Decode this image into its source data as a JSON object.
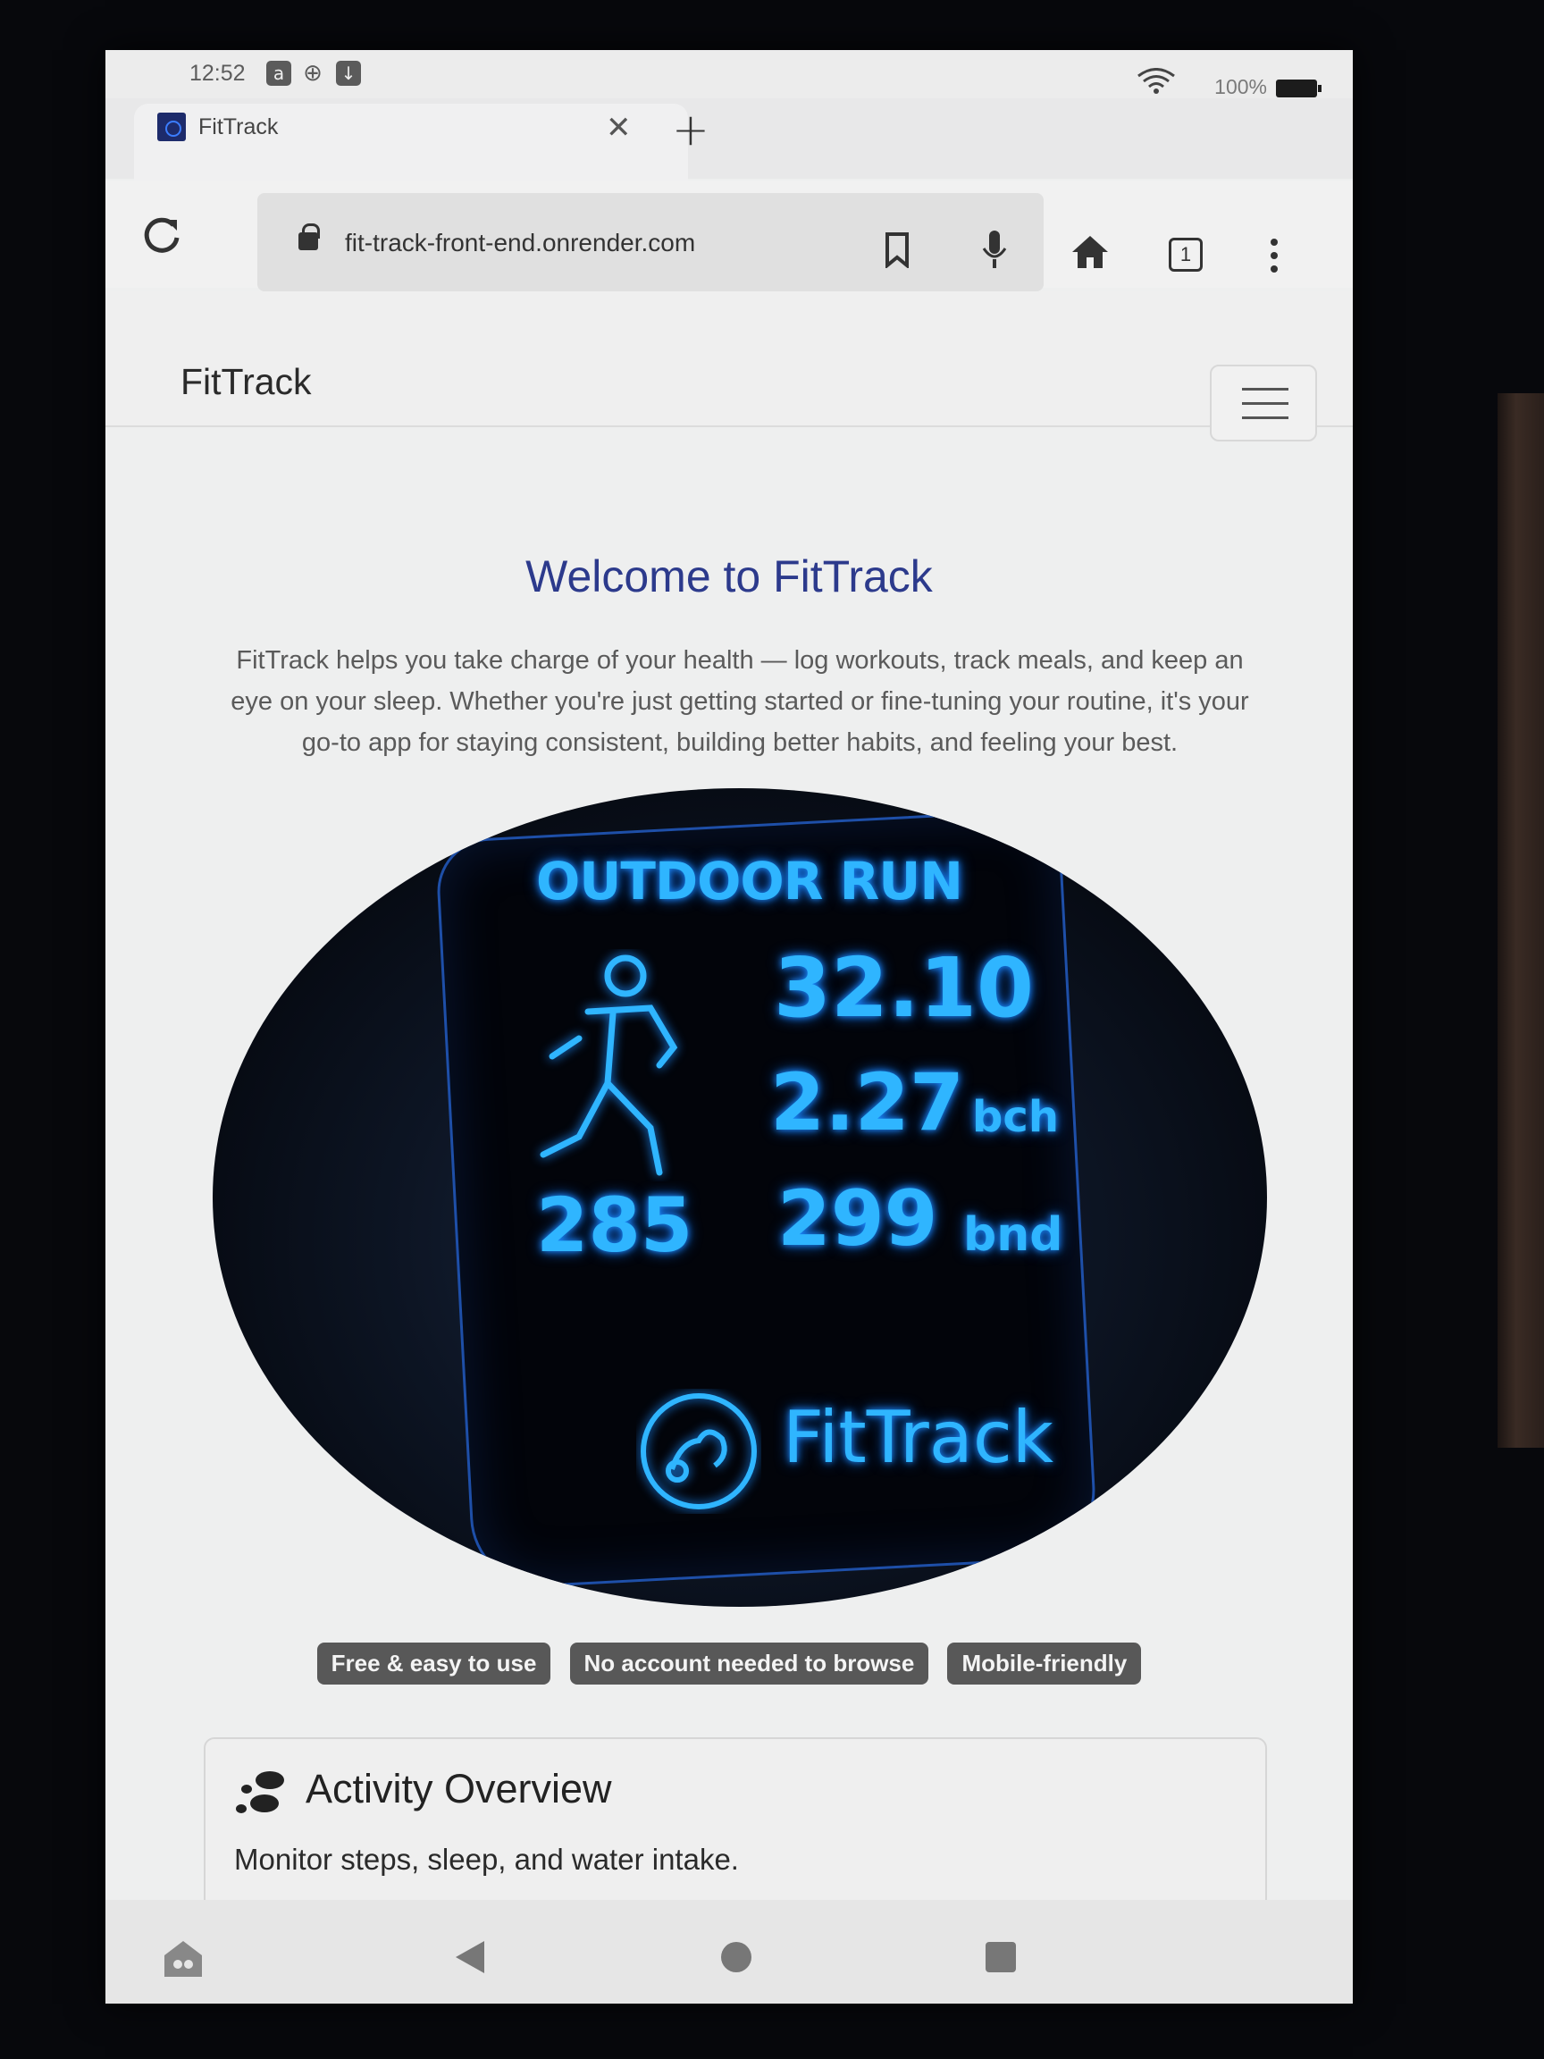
{
  "status_bar": {
    "time": "12:52",
    "battery": "100%",
    "icons": [
      "amazon-icon",
      "globe-icon",
      "download-icon",
      "wifi-icon",
      "battery-icon"
    ]
  },
  "browser": {
    "tab_title": "FitTrack",
    "url": "fit-track-front-end.onrender.com",
    "tab_count": "1"
  },
  "site": {
    "brand": "FitTrack",
    "heading": "Welcome to FitTrack",
    "intro": "FitTrack helps you take charge of your health — log workouts, track meals, and keep an eye on your sleep. Whether you're just getting started or fine-tuning your routine, it's your go-to app for staying consistent, building better habits, and feeling your best.",
    "hero": {
      "title": "OUTDOOR RUN",
      "value1": "32.10",
      "value2": "2.27",
      "unit2": "bch",
      "value3": "285",
      "value4": "299",
      "unit4": "bnd",
      "brand": "FitTrack"
    },
    "badges": [
      "Free & easy to use",
      "No account needed to browse",
      "Mobile-friendly"
    ],
    "card": {
      "title": "Activity Overview",
      "text": "Monitor steps, sleep, and water intake."
    }
  },
  "colors": {
    "heading": "#2c3a8c",
    "badge_bg": "#585858",
    "glow": "#2fb5ff"
  }
}
